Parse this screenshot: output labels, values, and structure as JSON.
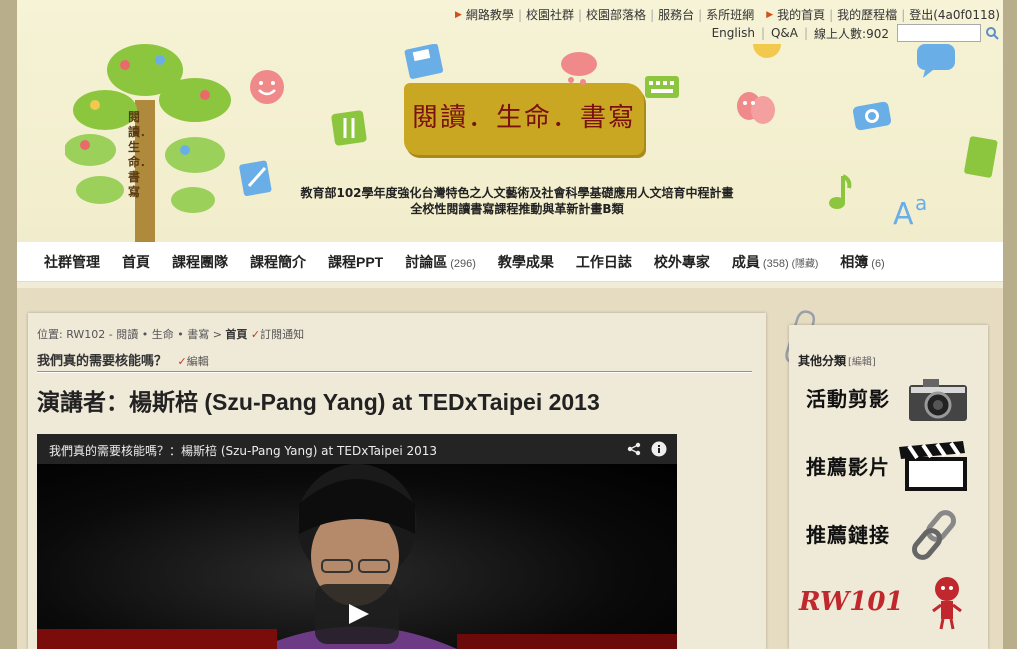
{
  "top_links": {
    "row1_left": [
      "網路教學",
      "校園社群",
      "校園部落格",
      "服務台",
      "系所班網"
    ],
    "row1_right": [
      "我的首頁",
      "我的歷程檔",
      "登出(4a0f0118)"
    ],
    "row2": [
      "English",
      "Q&A",
      "線上人數:902"
    ]
  },
  "header": {
    "logo": "閱讀．生命．書寫",
    "subtitle_line1": "教育部102學年度強化台灣特色之人文藝術及社會科學基礎應用人文培育中程計畫",
    "subtitle_line2": "全校性閱讀書寫課程推動與革新計畫B類",
    "tree_text": "閱讀．生命．書寫"
  },
  "nav": [
    {
      "label": "社群管理",
      "count": ""
    },
    {
      "label": "首頁",
      "count": ""
    },
    {
      "label": "課程團隊",
      "count": ""
    },
    {
      "label": "課程簡介",
      "count": ""
    },
    {
      "label": "課程PPT",
      "count": ""
    },
    {
      "label": "討論區",
      "count": "(296)"
    },
    {
      "label": "教學成果",
      "count": ""
    },
    {
      "label": "工作日誌",
      "count": ""
    },
    {
      "label": "校外專家",
      "count": ""
    },
    {
      "label": "成員",
      "count": "(358)",
      "extra": "(隱藏)"
    },
    {
      "label": "相簿",
      "count": "(6)"
    }
  ],
  "breadcrumb": {
    "prefix": "位置: RW102 - 閱讀 • 生命 • 書寫 > ",
    "current": "首頁",
    "subscribe": "訂閱通知"
  },
  "post": {
    "title": "我們真的需要核能嗎？",
    "edit": "編輯",
    "speaker": "演講者：楊斯棓 (Szu-Pang Yang) at TEDxTaipei 2013"
  },
  "video": {
    "title": "我們真的需要核能嗎？：楊斯棓 (Szu-Pang Yang) at TEDxTaipei 2013"
  },
  "sidebar": {
    "title": "其他分類",
    "edit": "[編輯]",
    "categories": [
      "活動剪影",
      "推薦影片",
      "推薦鏈接",
      "RW101"
    ]
  },
  "colors": {
    "nav_bg": "#ffffff",
    "header_bg": "#f4f0d2",
    "logo_gold": "#c9a723",
    "logo_red": "#8a0f0f",
    "accent_arrow": "#d2501a"
  }
}
